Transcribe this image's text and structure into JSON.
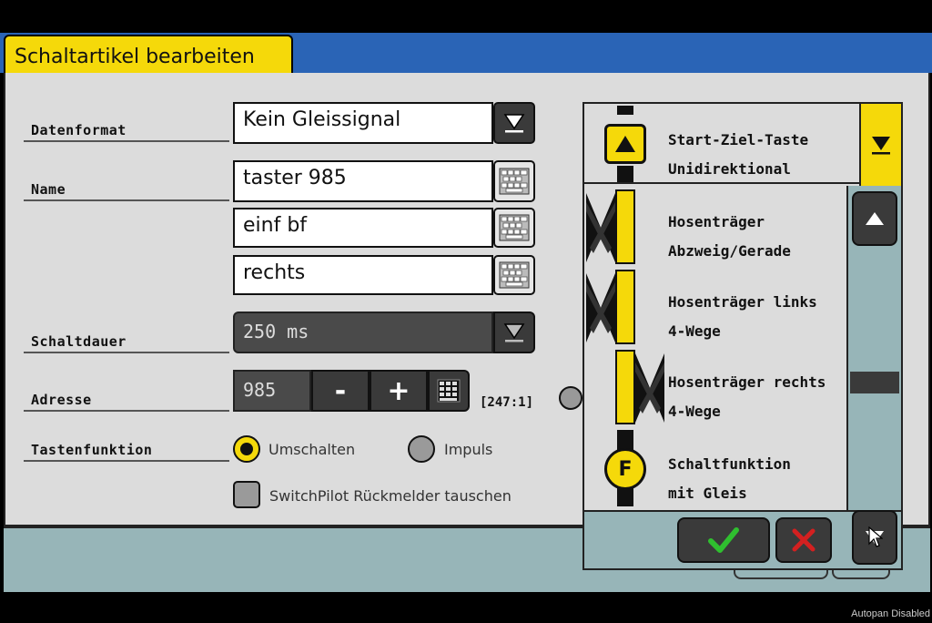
{
  "window": {
    "title": "Schaltartikel bearbeiten"
  },
  "form": {
    "datenformat": {
      "label": "Datenformat",
      "value": "Kein Gleissignal"
    },
    "name": {
      "label": "Name",
      "lines": [
        "taster 985",
        "einf bf",
        "rechts"
      ]
    },
    "schaltdauer": {
      "label": "Schaltdauer",
      "value": "250 ms"
    },
    "adresse": {
      "label": "Adresse",
      "value": "985",
      "minus": "-",
      "plus": "+",
      "info": "[247:1]"
    },
    "tastenfunktion": {
      "label": "Tastenfunktion",
      "option1": "Umschalten",
      "option2": "Impuls",
      "selected": "Umschalten"
    },
    "switchpilot": {
      "label": "SwitchPilot Rückmelder tauschen"
    }
  },
  "list": {
    "header": {
      "line1": "Start-Ziel-Taste",
      "line2": "Unidirektional"
    },
    "items": [
      {
        "line1": "Hosenträger",
        "line2": "Abzweig/Gerade"
      },
      {
        "line1": "Hosenträger links",
        "line2": "4-Wege"
      },
      {
        "line1": "Hosenträger rechts",
        "line2": "4-Wege"
      },
      {
        "line1": "Schaltfunktion",
        "line2": "mit Gleis"
      }
    ],
    "icon_letter": "F"
  },
  "icons": {
    "dropdown": "chevron-down-icon",
    "keyboard": "keyboard-icon",
    "keypad": "keypad-icon",
    "ok": "check-icon",
    "cancel": "close-icon",
    "scroll_up": "arrow-up-icon",
    "scroll_down": "arrow-down-icon"
  },
  "colors": {
    "accent": "#f5d90a",
    "title_bar": "#2a64b6",
    "ok": "#2fbf2f",
    "cancel": "#d32020"
  },
  "status": {
    "autopan": "Autopan Disabled"
  }
}
